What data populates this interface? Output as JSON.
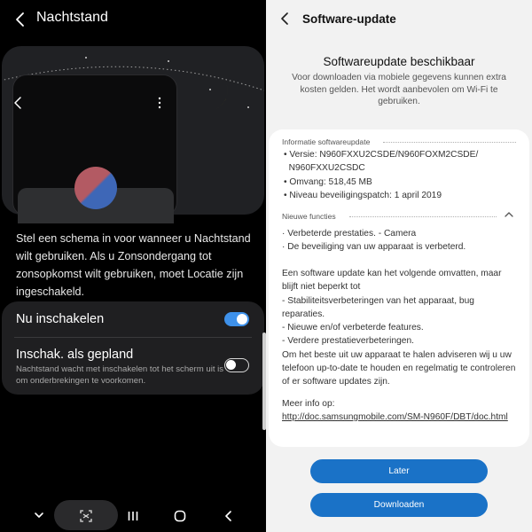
{
  "left": {
    "title": "Nachtstand",
    "description": "Stel een schema in voor wanneer u Nachtstand wilt gebruiken. Als u Zonsondergang tot zonsopkomst wilt gebruiken, moet Locatie zijn ingeschakeld.",
    "settings": {
      "enable_now": {
        "label": "Nu inschakelen",
        "on": true
      },
      "scheduled": {
        "label": "Inschak. als gepland",
        "sub": "Nachtstand wacht met inschakelen tot het scherm uit is om onderbrekingen te voorkomen.",
        "on": false
      }
    },
    "accent_color": "#3e91ea",
    "moon_color": "#f5c518",
    "icons": [
      "back-arrow-icon",
      "moon-icon",
      "chevron-down-icon",
      "screenshot-icon",
      "recents-icon",
      "home-icon",
      "back-icon"
    ]
  },
  "right": {
    "title": "Software-update",
    "heading": "Softwareupdate beschikbaar",
    "intro": "Voor downloaden via mobiele gegevens kunnen extra kosten gelden. Het wordt aanbevolen om Wi-Fi te gebruiken.",
    "info_header": "Informatie softwareupdate",
    "info_items": [
      "• Versie: N960FXXU2CSDE/N960FOXM2CSDE/",
      "  N960FXXU2CSDC",
      "• Omvang: 518,45 MB",
      "• Niveau beveiligingspatch: 1 april 2019"
    ],
    "features_header": "Nieuwe functies",
    "features_text": "· Verbeterde prestaties. - Camera\n· De beveiliging van uw apparaat is verbeterd.",
    "body_text": "Een software update kan het volgende omvatten, maar blijft niet beperkt tot\n - Stabiliteitsverbeteringen van het apparaat, bug reparaties.\n - Nieuwe en/of verbeterde features.\n - Verdere prestatieverbeteringen.\nOm het beste uit uw apparaat te halen adviseren wij u uw telefoon up-to-date te houden en regelmatig te controleren of er software updates zijn.",
    "more_info_label": "Meer info op:",
    "more_info_link": "http://doc.samsungmobile.com/SM-N960F/DBT/doc.html",
    "buttons": {
      "later": "Later",
      "download": "Downloaden"
    },
    "button_color": "#1a72c7"
  }
}
